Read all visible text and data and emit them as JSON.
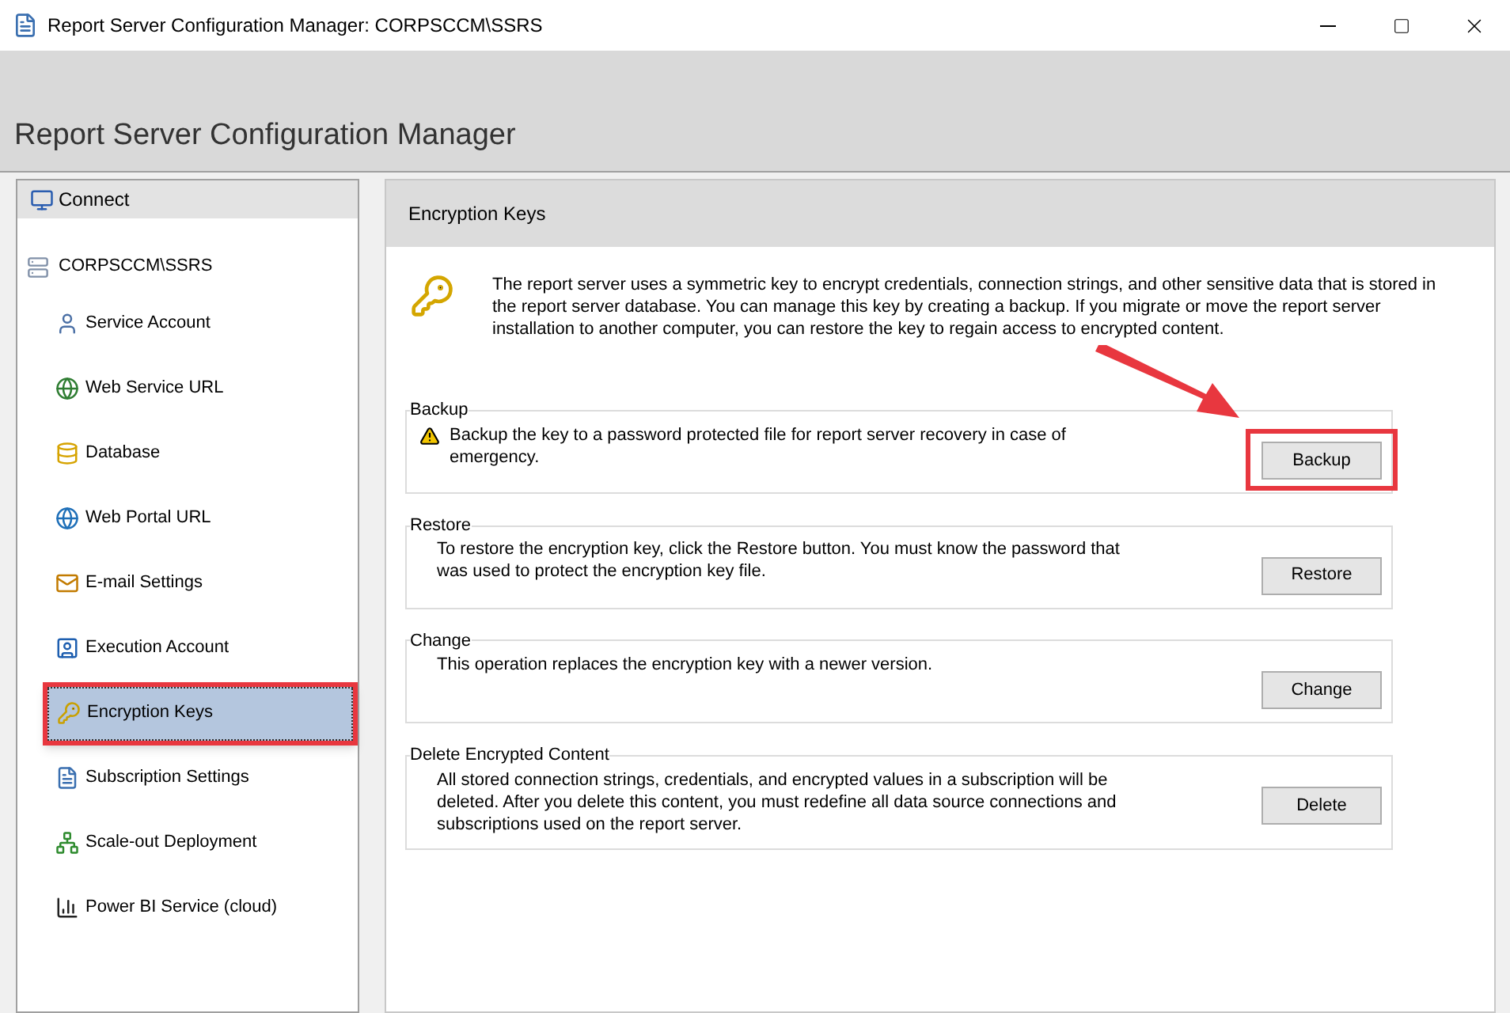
{
  "window": {
    "title": "Report Server Configuration Manager: CORPSCCM\\SSRS"
  },
  "header": {
    "title": "Report Server Configuration Manager"
  },
  "sidebar": {
    "connect": "Connect",
    "server": "CORPSCCM\\SSRS",
    "items": [
      {
        "label": "Service Account",
        "selected": false,
        "highlighted": false
      },
      {
        "label": "Web Service URL",
        "selected": false,
        "highlighted": false
      },
      {
        "label": "Database",
        "selected": false,
        "highlighted": false
      },
      {
        "label": "Web Portal URL",
        "selected": false,
        "highlighted": false
      },
      {
        "label": "E-mail Settings",
        "selected": false,
        "highlighted": false
      },
      {
        "label": "Execution Account",
        "selected": false,
        "highlighted": false
      },
      {
        "label": "Encryption Keys",
        "selected": true,
        "highlighted": true
      },
      {
        "label": "Subscription Settings",
        "selected": false,
        "highlighted": false
      },
      {
        "label": "Scale-out Deployment",
        "selected": false,
        "highlighted": false
      },
      {
        "label": "Power BI Service (cloud)",
        "selected": false,
        "highlighted": false
      }
    ]
  },
  "page": {
    "title": "Encryption Keys",
    "intro": "The report server uses a symmetric key to encrypt credentials, connection strings, and other sensitive data that is stored in the report server database.  You can manage this key by creating a backup.  If you migrate or move the report server installation to another computer, you can restore the key to regain access to encrypted content.",
    "sections": [
      {
        "title": "Backup",
        "text": "Backup the key to a password protected file for report server recovery in case of emergency.",
        "warning": true,
        "button": "Backup",
        "highlighted": true
      },
      {
        "title": "Restore",
        "text": "To restore the encryption key, click the Restore button.  You must know the password that was used to protect the encryption key file.",
        "warning": false,
        "button": "Restore",
        "highlighted": false
      },
      {
        "title": "Change",
        "text": "This operation replaces the encryption key with a newer version.",
        "warning": false,
        "button": "Change",
        "highlighted": false
      },
      {
        "title": "Delete Encrypted Content",
        "text": "All stored connection strings, credentials, and encrypted values in a subscription will be deleted.  After you delete this content, you must redefine all data source connections and subscriptions used on the report server.",
        "warning": false,
        "button": "Delete",
        "highlighted": false
      }
    ]
  }
}
